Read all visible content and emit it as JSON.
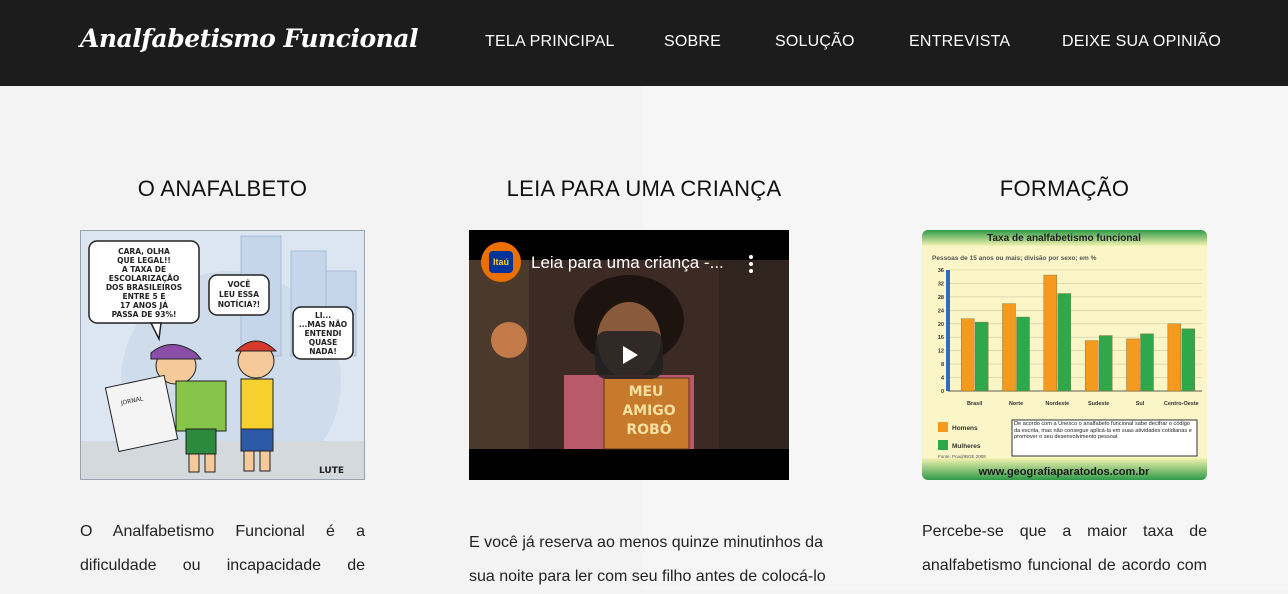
{
  "header": {
    "logo": "Analfabetismo Funcional",
    "nav": [
      "TELA PRINCIPAL",
      "SOBRE",
      "SOLUÇÃO",
      "ENTREVISTA",
      "DEIXE SUA OPINIÃO"
    ]
  },
  "columns": [
    {
      "title": "O ANAFALBETO",
      "comic": {
        "bubble1": [
          "CARA, OLHA",
          "QUE LEGAL!!",
          "A TAXA DE",
          "ESCOLARIZAÇÃO",
          "DOS BRASILEIROS",
          "ENTRE 5 E",
          "17 ANOS JÁ",
          "PASSA DE 93%!"
        ],
        "bubble2": [
          "VOCÊ",
          "LEU ESSA",
          "NOTÍCIA?!"
        ],
        "bubble3": [
          "LI...",
          "...MAS NÃO",
          "ENTENDI",
          "QUASE",
          "NADA!"
        ],
        "newspaper": "JORNAL",
        "signature": "LUTE"
      },
      "text_lines": [
        "O Analfabetismo Funcional é a",
        "dificuldade ou incapacidade de"
      ]
    },
    {
      "title": "LEIA PARA UMA CRIANÇA",
      "video": {
        "channel": "Itaú",
        "title": "Leia para uma criança -...",
        "book_lines": [
          "MEU",
          "AMIGO",
          "ROBÔ"
        ]
      },
      "text_lines": [
        "E você já reserva ao menos quinze minutinhos da",
        "sua noite para ler com seu filho antes de colocá-lo"
      ]
    },
    {
      "title": "FORMAÇÃO",
      "chart_title": "Taxa de analfabetismo funcional",
      "chart_subtitle": "Pessoas de 15 anos ou mais; divisão por sexo; em %",
      "legend": [
        "Homens",
        "Mulheres"
      ],
      "chart_note": "De acordo com a Unesco o analfabeto funcional sabe decifrar o código da escrita, mas não consegue aplicá-la em suas atividades cotidianas e promover o seu desenvolvimento pessoal.",
      "chart_source": "Fonte: Pnad/IBGE 2008",
      "chart_footer": "www.geografiaparatodos.com.br",
      "text_lines": [
        "Percebe-se que a maior taxa de",
        "analfabetismo funcional de acordo com"
      ]
    }
  ],
  "chart_data": {
    "type": "bar",
    "title": "Taxa de analfabetismo funcional",
    "subtitle": "Pessoas de 15 anos ou mais; divisão por sexo; em %",
    "categories": [
      "Brasil",
      "Norte",
      "Nordeste",
      "Sudeste",
      "Sul",
      "Centro-Oeste"
    ],
    "series": [
      {
        "name": "Homens",
        "values": [
          21.5,
          26,
          34.5,
          15,
          15.5,
          20
        ],
        "color": "#f39a1f"
      },
      {
        "name": "Mulheres",
        "values": [
          20.5,
          22,
          29,
          16.5,
          17,
          18.5
        ],
        "color": "#2ea84a"
      }
    ],
    "yticks": [
      0,
      4,
      8,
      12,
      16,
      20,
      24,
      28,
      32,
      36
    ],
    "ylim": [
      0,
      36
    ]
  }
}
